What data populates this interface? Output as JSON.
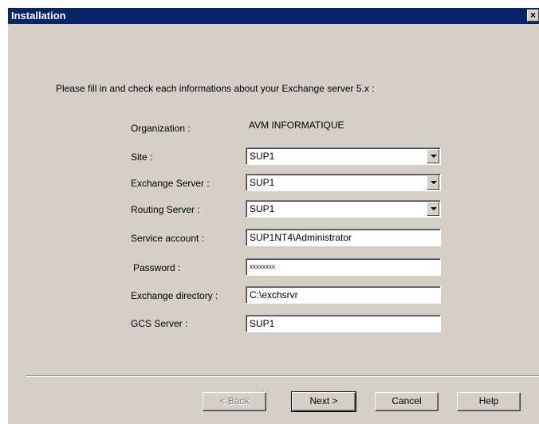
{
  "window": {
    "title": "Installation",
    "close_label": "×"
  },
  "instruction": "Please fill in and check each informations about your Exchange server 5.x :",
  "form": {
    "organization": {
      "label": "Organization :",
      "value": "AVM INFORMATIQUE"
    },
    "site": {
      "label": "Site :",
      "value": "SUP1"
    },
    "exchange_server": {
      "label": "Exchange Server :",
      "value": "SUP1"
    },
    "routing_server": {
      "label": "Routing Server :",
      "value": "SUP1"
    },
    "service_account": {
      "label": "Service account :",
      "value": "SUP1NT4\\Administrator"
    },
    "password": {
      "label": "Password :",
      "value": "xxxxxxxx"
    },
    "exchange_directory": {
      "label": "Exchange directory :",
      "value": "C:\\exchsrvr"
    },
    "gcs_server": {
      "label": "GCS Server :",
      "value": "SUP1"
    }
  },
  "buttons": {
    "back": "< Back",
    "next": "Next >",
    "cancel": "Cancel",
    "help": "Help"
  },
  "icons": {
    "close": "close-icon",
    "dropdown": "chevron-down-icon"
  }
}
